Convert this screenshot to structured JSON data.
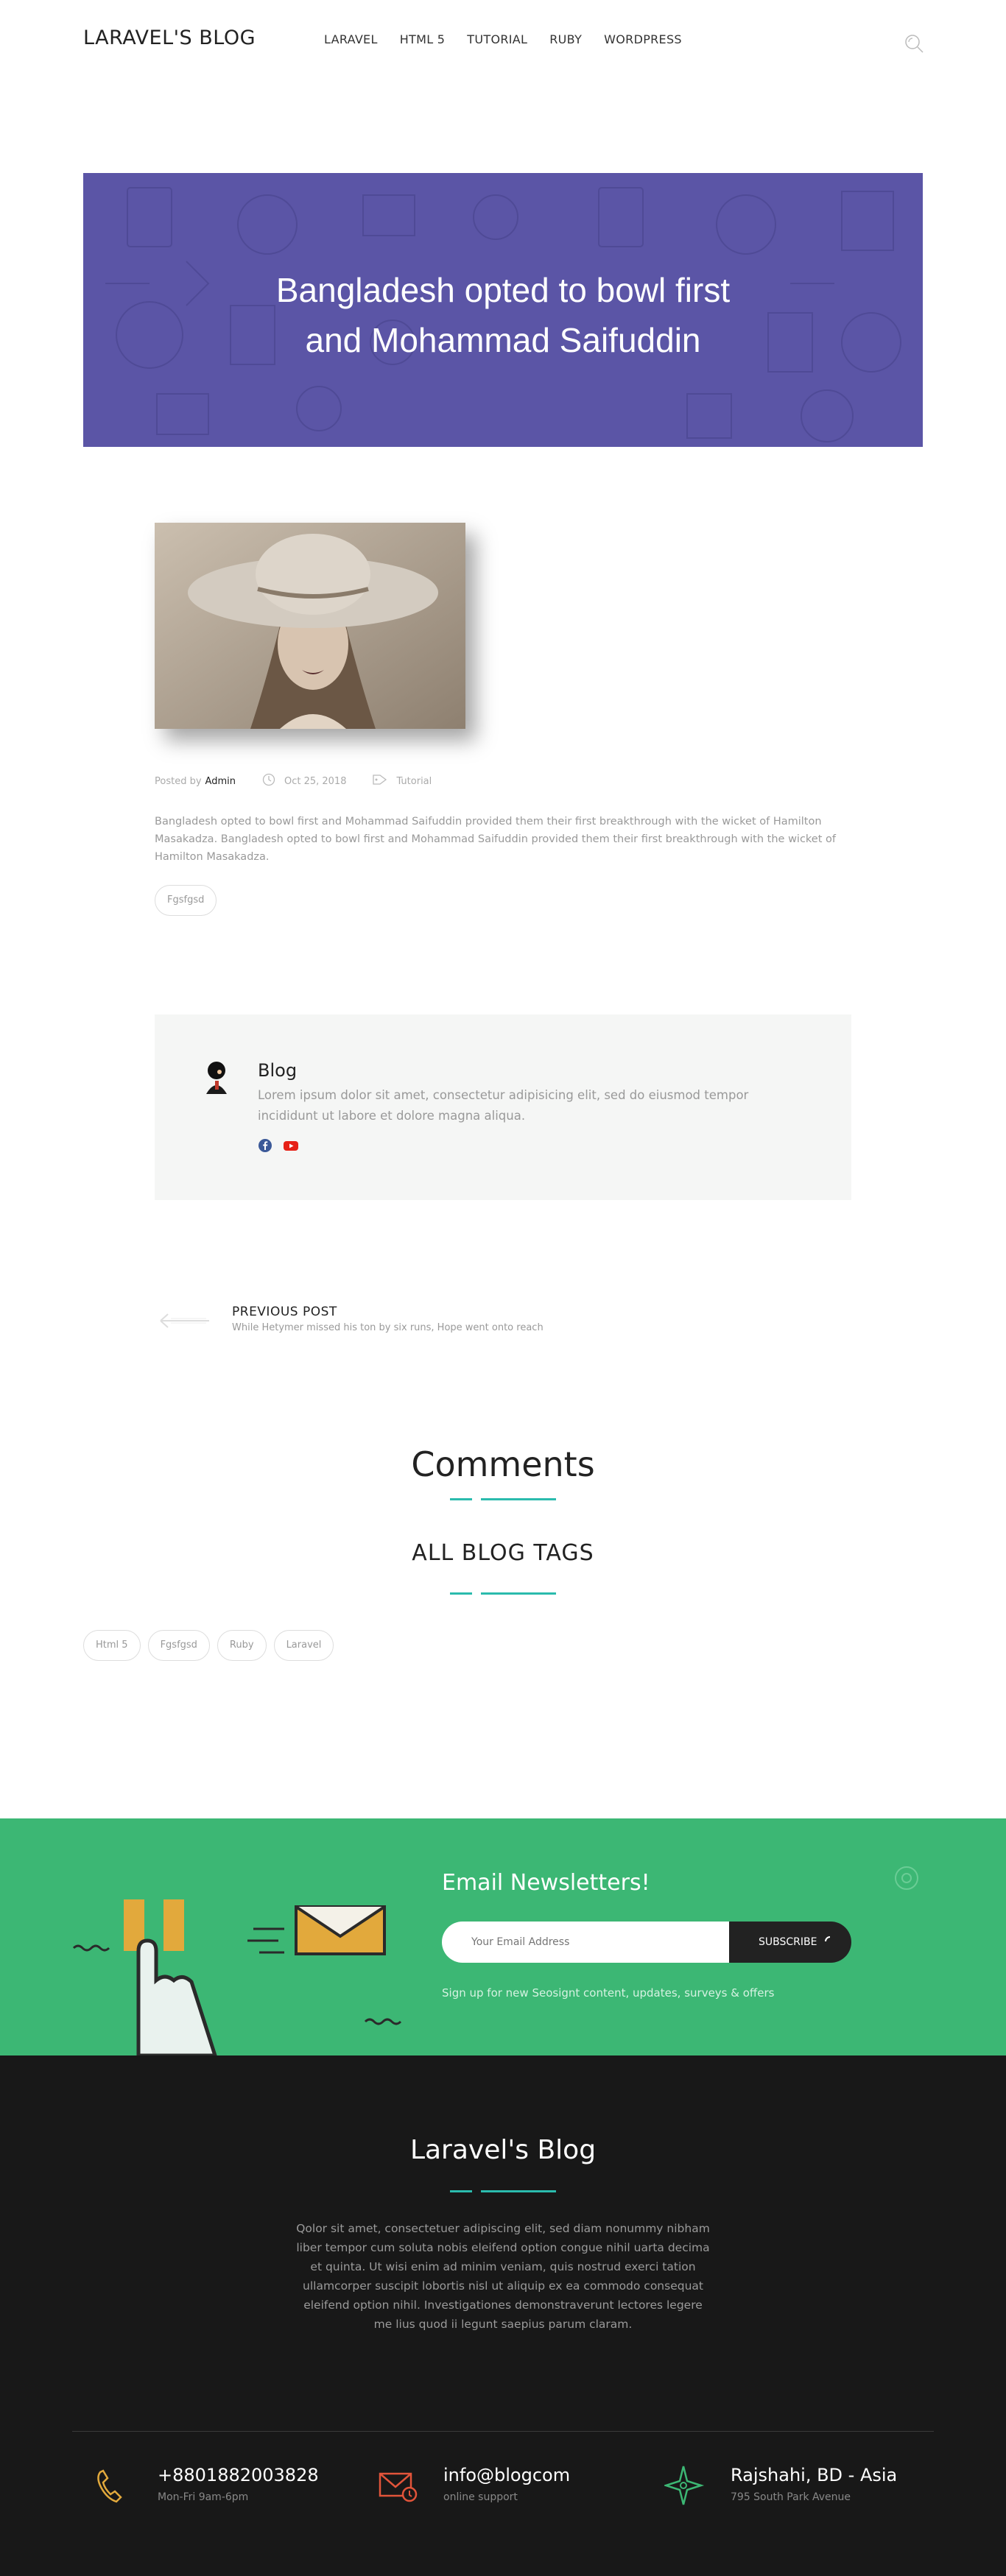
{
  "header": {
    "logo": "LARAVEL'S BLOG",
    "nav": [
      "LARAVEL",
      "HTML 5",
      "TUTORIAL",
      "RUBY",
      "WORDPRESS"
    ]
  },
  "hero": {
    "title_line1": "Bangladesh opted to bowl first",
    "title_line2": "and Mohammad Saifuddin",
    "background": "#5b55a6"
  },
  "post": {
    "posted_by_label": "Posted by",
    "author": "Admin",
    "date": "Oct 25, 2018",
    "category": "Tutorial",
    "excerpt": "Bangladesh opted to bowl first and Mohammad Saifuddin provided them their first breakthrough with the wicket of Hamilton Masakadza. Bangladesh opted to bowl first and Mohammad Saifuddin provided them their first breakthrough with the wicket of Hamilton Masakadza.",
    "tag": "Fgsfgsd"
  },
  "author_box": {
    "name": "Blog",
    "bio": "Lorem ipsum dolor sit amet, consectetur adipisicing elit, sed do eiusmod tempor incididunt ut labore et dolore magna aliqua.",
    "socials": [
      "facebook-icon",
      "youtube-icon"
    ]
  },
  "prev_post": {
    "label": "PREVIOUS POST",
    "title": "While Hetymer missed his ton by six runs, Hope went onto reach"
  },
  "comments": {
    "title": "Comments"
  },
  "tags_section": {
    "title": "ALL BLOG TAGS",
    "tags": [
      "Html 5",
      "Fgsfgsd",
      "Ruby",
      "Laravel"
    ]
  },
  "newsletter": {
    "title": "Email Newsletters!",
    "placeholder": "Your Email Address",
    "button": "SUBSCRIBE",
    "note": "Sign up for new Seosignt content, updates, surveys & offers",
    "background": "#3cb774"
  },
  "footer": {
    "title": "Laravel's Blog",
    "text": "Qolor sit amet, consectetuer adipiscing elit, sed diam nonummy nibham liber tempor cum soluta nobis eleifend option congue nihil uarta decima et quinta. Ut wisi enim ad minim veniam, quis nostrud exerci tation ullamcorper suscipit lobortis nisl ut aliquip ex ea commodo consequat eleifend option nihil. Investigationes demonstraverunt lectores legere me lius quod ii legunt saepius parum claram.",
    "contacts": [
      {
        "main": "+8801882003828",
        "sub": "Mon-Fri 9am-6pm"
      },
      {
        "main": "info@blogcom",
        "sub": "online support"
      },
      {
        "main": "Rajshahi, BD - Asia",
        "sub": "795 South Park Avenue"
      }
    ]
  },
  "colors": {
    "accent": "#2bbbad",
    "footer_bg": "#181818"
  }
}
